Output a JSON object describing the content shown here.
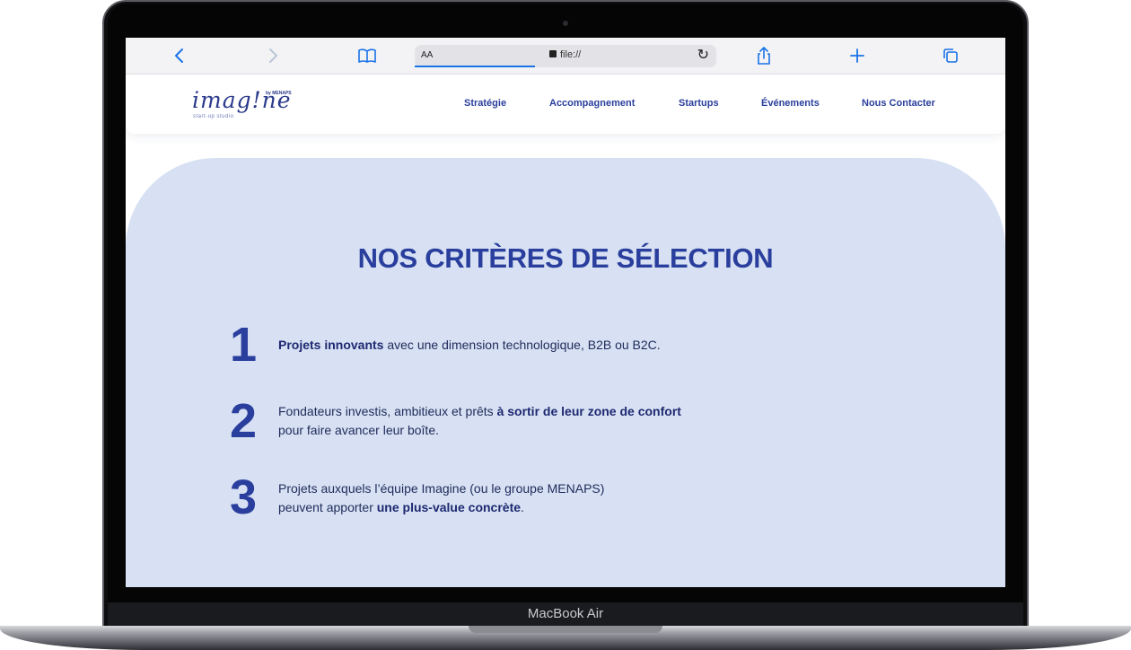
{
  "device": {
    "model_label": "MacBook Air"
  },
  "browser": {
    "address_bar": {
      "text_size_label": "AA",
      "url": "file://"
    },
    "icons": {
      "back": "chevron-left-icon",
      "forward": "chevron-right-icon",
      "bookmarks": "book-icon",
      "reload": "reload-icon",
      "share": "share-icon",
      "new_tab": "plus-icon",
      "tabs": "tabs-icon"
    },
    "accent_color": "#1a73e8"
  },
  "site": {
    "logo": {
      "word": "imag!ne",
      "by": "by MENAPS",
      "tagline": "start-up studio"
    },
    "nav": [
      "Stratégie",
      "Accompagnement",
      "Startups",
      "Événements",
      "Nous Contacter"
    ],
    "brand_color": "#2a3f9d",
    "panel_color": "#d7e1f3"
  },
  "section": {
    "title": "NOS CRITÈRES DE SÉLECTION",
    "criteria": [
      {
        "number": "1",
        "line1_bold": "Projets innovants",
        "line1_rest": " avec une dimension technologique, B2B ou B2C."
      },
      {
        "number": "2",
        "line1_start": "Fondateurs investis, ambitieux et prêts ",
        "line1_bold": "à sortir de leur zone de confort",
        "line2": "pour faire avancer leur boîte."
      },
      {
        "number": "3",
        "line1": "Projets auxquels l’équipe Imagine (ou le groupe MENAPS)",
        "line2_start": "peuvent apporter ",
        "line2_bold": "une plus-value concrète",
        "line2_end": "."
      }
    ]
  }
}
